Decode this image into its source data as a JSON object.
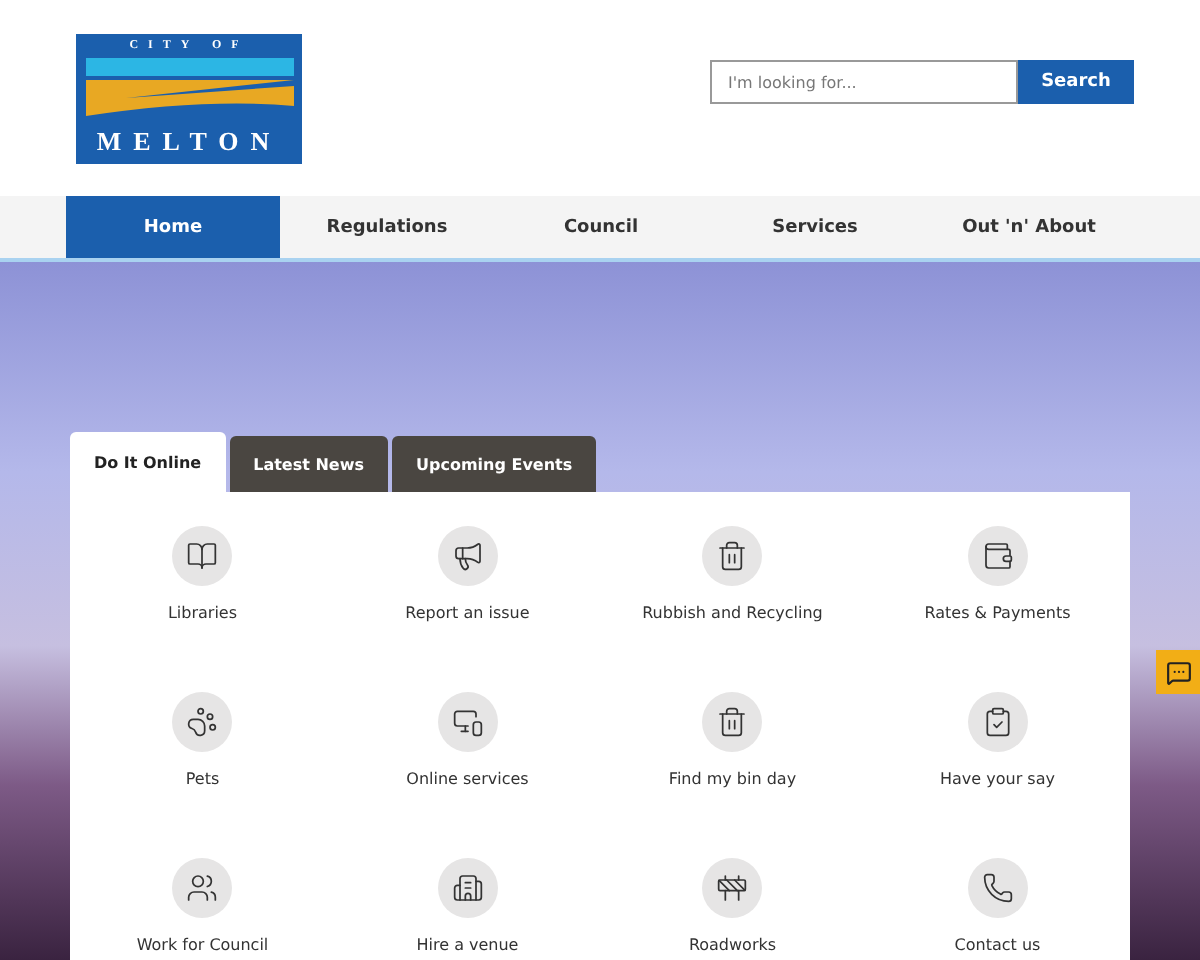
{
  "logo": {
    "top": "CITY OF",
    "name": "MELTON"
  },
  "search": {
    "placeholder": "I'm looking for...",
    "button": "Search"
  },
  "nav": [
    {
      "label": "Home",
      "selected": true
    },
    {
      "label": "Regulations",
      "selected": false
    },
    {
      "label": "Council",
      "selected": false
    },
    {
      "label": "Services",
      "selected": false
    },
    {
      "label": "Out 'n' About",
      "selected": false
    }
  ],
  "tabs": [
    {
      "label": "Do It Online",
      "selected": true
    },
    {
      "label": "Latest News",
      "selected": false
    },
    {
      "label": "Upcoming Events",
      "selected": false
    }
  ],
  "services": [
    {
      "label": "Libraries"
    },
    {
      "label": "Report an issue"
    },
    {
      "label": "Rubbish and Recycling"
    },
    {
      "label": "Rates & Payments"
    },
    {
      "label": "Pets"
    },
    {
      "label": "Online services"
    },
    {
      "label": "Find my bin day"
    },
    {
      "label": "Have your say"
    },
    {
      "label": "Work for Council"
    },
    {
      "label": "Hire a venue"
    },
    {
      "label": "Roadworks"
    },
    {
      "label": "Contact us"
    }
  ]
}
